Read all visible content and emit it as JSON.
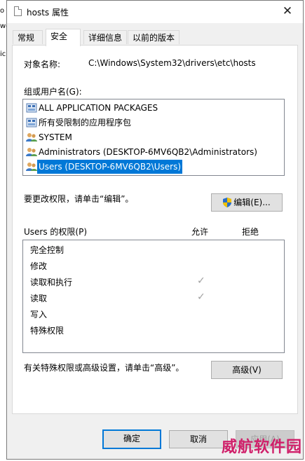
{
  "background_letters": [
    "o",
    "wo",
    "ic"
  ],
  "window": {
    "title": "hosts 属性",
    "close_glyph": "✕"
  },
  "tabs": [
    {
      "label": "常规"
    },
    {
      "label": "安全",
      "active": true
    },
    {
      "label": "详细信息"
    },
    {
      "label": "以前的版本"
    }
  ],
  "object": {
    "label": "对象名称:",
    "value": "C:\\Windows\\System32\\drivers\\etc\\hosts"
  },
  "groups": {
    "label": "组或用户名(G):",
    "items": [
      {
        "name": "ALL APPLICATION PACKAGES",
        "icon": "package-icon"
      },
      {
        "name": "所有受限制的应用程序包",
        "icon": "package-icon"
      },
      {
        "name": "SYSTEM",
        "icon": "users-icon"
      },
      {
        "name": "Administrators (DESKTOP-6MV6QB2\\Administrators)",
        "icon": "users-icon"
      },
      {
        "name": "Users (DESKTOP-6MV6QB2\\Users)",
        "icon": "users-icon",
        "selected": true
      }
    ]
  },
  "change_perm_text": "要更改权限，请单击“编辑”。",
  "edit_button": "编辑(E)...",
  "permissions": {
    "label": "Users 的权限(P)",
    "allow_header": "允许",
    "deny_header": "拒绝",
    "rows": [
      {
        "name": "完全控制",
        "allow": false,
        "deny": false
      },
      {
        "name": "修改",
        "allow": false,
        "deny": false
      },
      {
        "name": "读取和执行",
        "allow": true,
        "deny": false
      },
      {
        "name": "读取",
        "allow": true,
        "deny": false
      },
      {
        "name": "写入",
        "allow": false,
        "deny": false
      },
      {
        "name": "特殊权限",
        "allow": false,
        "deny": false
      }
    ],
    "check_glyph": "✓"
  },
  "advanced_text": "有关特殊权限或高级设置，请单击“高级”。",
  "advanced_button": "高级(V)",
  "footer": {
    "ok": "确定",
    "cancel": "取消",
    "apply": "应用(A)"
  },
  "watermark": "威航软件园",
  "colors": {
    "selection": "#0078d7",
    "watermark": "#d0206a"
  }
}
